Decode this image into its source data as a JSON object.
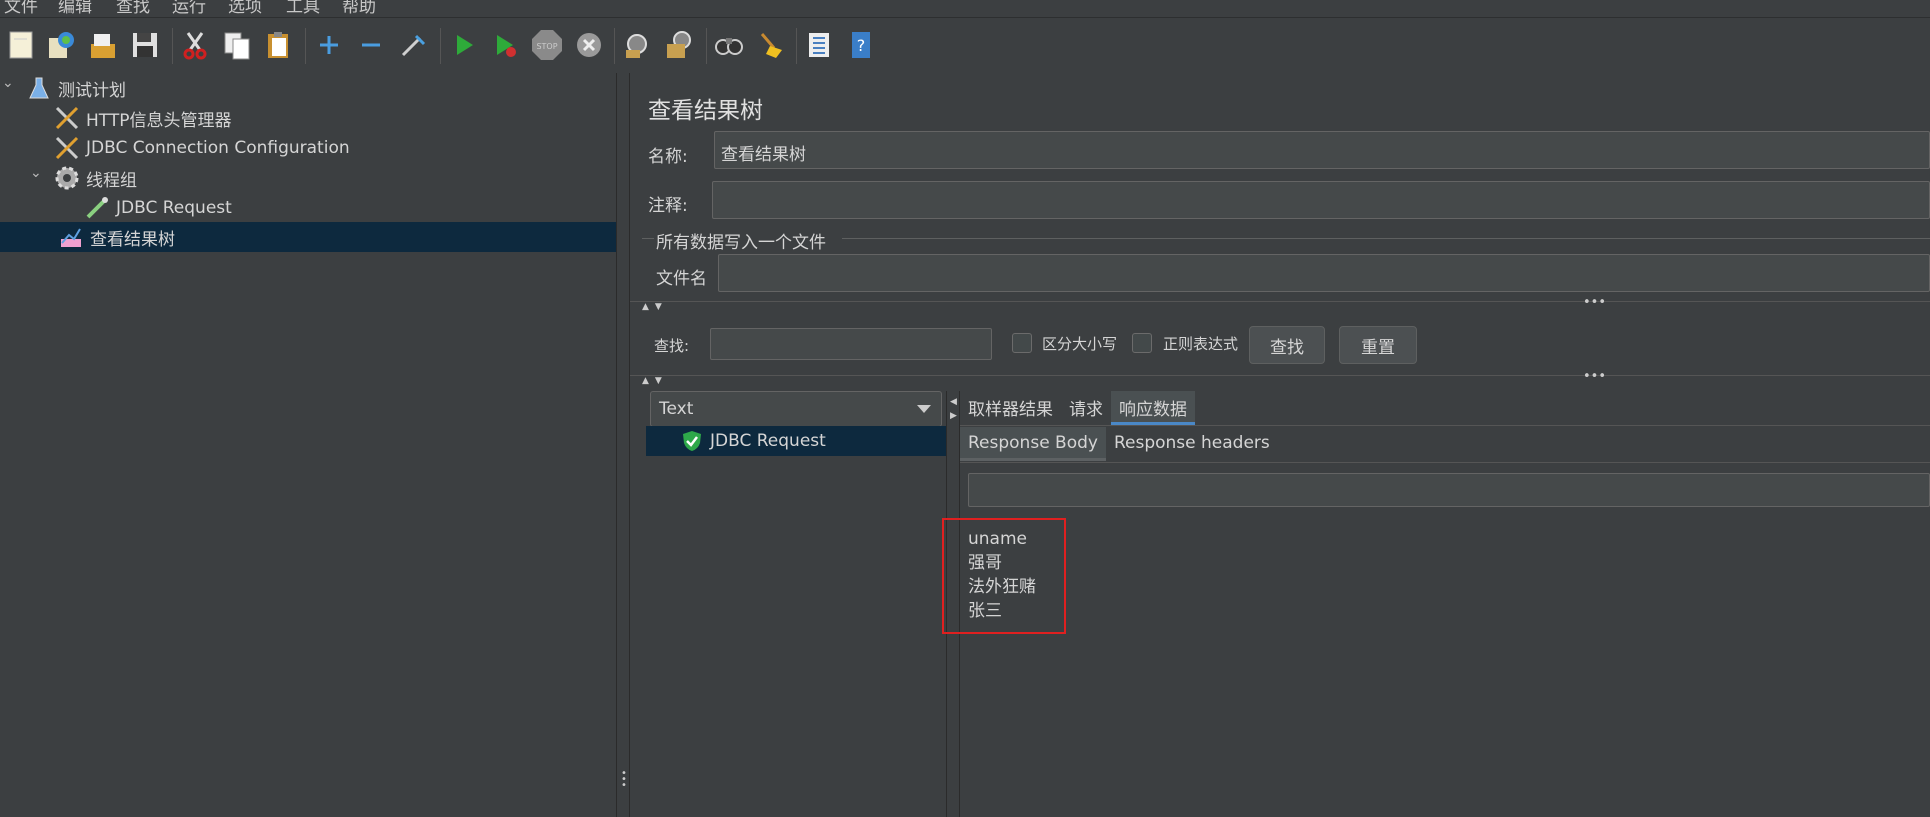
{
  "menubar": {
    "items": [
      "文件",
      "编辑",
      "查找",
      "运行",
      "选项",
      "工具",
      "帮助"
    ]
  },
  "toolbar": {
    "buttons": [
      "new-icon",
      "templates-icon",
      "open-icon",
      "save-icon",
      "cut-icon",
      "copy-icon",
      "paste-icon",
      "expand-icon",
      "collapse-icon",
      "toggle-icon",
      "start-icon",
      "start-no-pause-icon",
      "stop-icon",
      "shutdown-icon",
      "clear-icon",
      "clear-all-icon",
      "search-icon",
      "reset-search-icon",
      "function-helper-icon",
      "help-icon"
    ]
  },
  "tree": {
    "items": [
      {
        "label": "测试计划",
        "icon": "flask-icon"
      },
      {
        "label": "HTTP信息头管理器",
        "icon": "tools-icon"
      },
      {
        "label": "JDBC Connection Configuration",
        "icon": "tools-icon"
      },
      {
        "label": "线程组",
        "icon": "gear-icon"
      },
      {
        "label": "JDBC Request",
        "icon": "pipette-icon"
      },
      {
        "label": "查看结果树",
        "icon": "chart-icon"
      }
    ]
  },
  "panel": {
    "title": "查看结果树",
    "name_label": "名称:",
    "name_value": "查看结果树",
    "comment_label": "注释:",
    "comment_value": "",
    "file_group_label": "所有数据写入一个文件",
    "filename_label": "文件名",
    "filename_value": "",
    "search_label": "查找:",
    "search_value": "",
    "case_label": "区分大小写",
    "regex_label": "正则表达式",
    "find_button": "查找",
    "reset_button": "重置",
    "renderer": "Text",
    "results": [
      {
        "label": "JDBC Request",
        "status": "success"
      }
    ],
    "tabs": [
      "取样器结果",
      "请求",
      "响应数据"
    ],
    "active_tab": "响应数据",
    "subtabs": [
      "Response Body",
      "Response headers"
    ],
    "active_subtab": "Response Body",
    "response_lines": [
      "uname",
      "强哥",
      "法外狂赌",
      "张三"
    ]
  },
  "colors": {
    "background": "#3c3f41",
    "selection": "#0d293e",
    "highlight_box": "#e02020",
    "tab_accent": "#4a88c7"
  }
}
